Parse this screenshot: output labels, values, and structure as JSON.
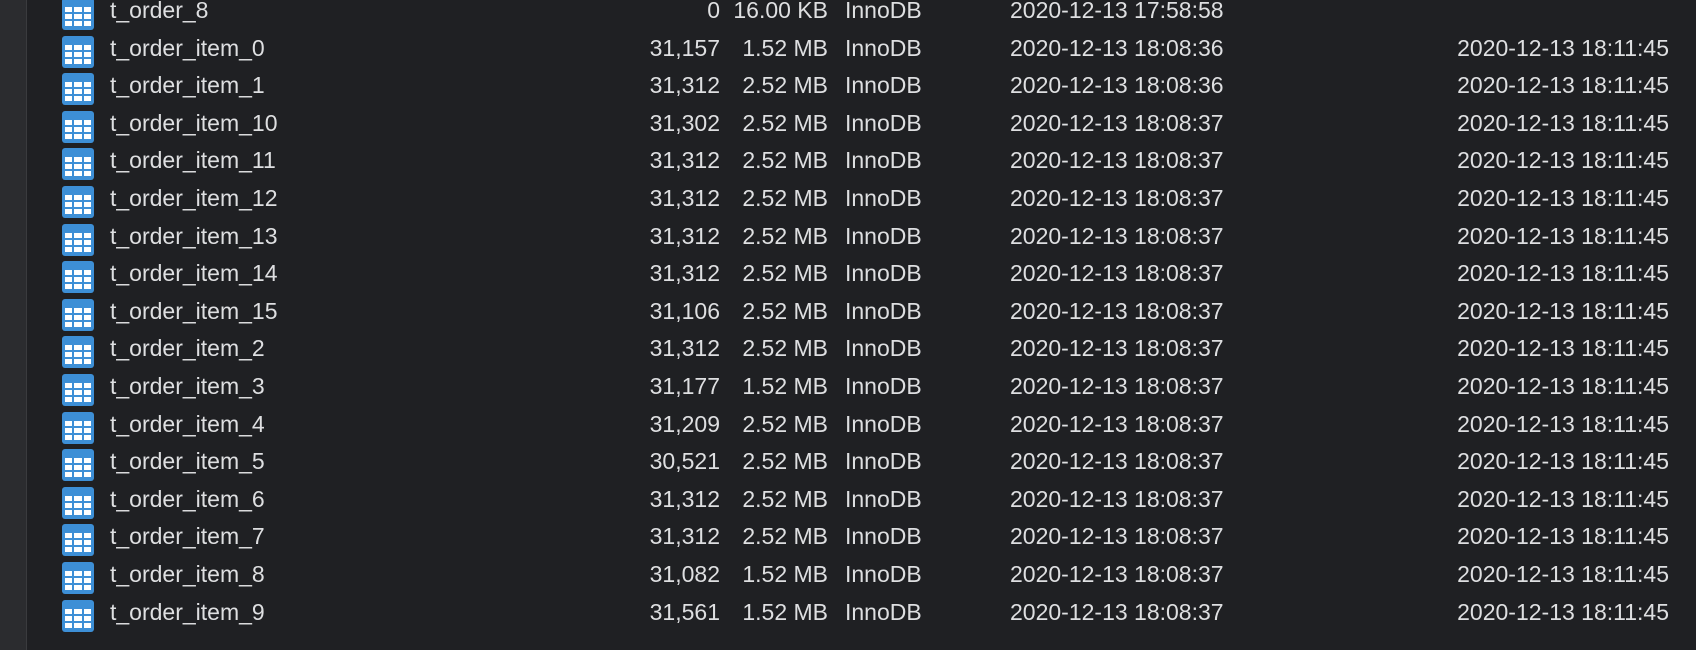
{
  "colors": {
    "background": "#1f2023",
    "text": "#dedfe1",
    "icon": "#3d8fd6"
  },
  "rows": [
    {
      "name": "t_order_8",
      "rows": "0",
      "size": "16.00 KB",
      "engine": "InnoDB",
      "created": "2020-12-13 17:58:58",
      "updated": ""
    },
    {
      "name": "t_order_item_0",
      "rows": "31,157",
      "size": "1.52 MB",
      "engine": "InnoDB",
      "created": "2020-12-13 18:08:36",
      "updated": "2020-12-13 18:11:45"
    },
    {
      "name": "t_order_item_1",
      "rows": "31,312",
      "size": "2.52 MB",
      "engine": "InnoDB",
      "created": "2020-12-13 18:08:36",
      "updated": "2020-12-13 18:11:45"
    },
    {
      "name": "t_order_item_10",
      "rows": "31,302",
      "size": "2.52 MB",
      "engine": "InnoDB",
      "created": "2020-12-13 18:08:37",
      "updated": "2020-12-13 18:11:45"
    },
    {
      "name": "t_order_item_11",
      "rows": "31,312",
      "size": "2.52 MB",
      "engine": "InnoDB",
      "created": "2020-12-13 18:08:37",
      "updated": "2020-12-13 18:11:45"
    },
    {
      "name": "t_order_item_12",
      "rows": "31,312",
      "size": "2.52 MB",
      "engine": "InnoDB",
      "created": "2020-12-13 18:08:37",
      "updated": "2020-12-13 18:11:45"
    },
    {
      "name": "t_order_item_13",
      "rows": "31,312",
      "size": "2.52 MB",
      "engine": "InnoDB",
      "created": "2020-12-13 18:08:37",
      "updated": "2020-12-13 18:11:45"
    },
    {
      "name": "t_order_item_14",
      "rows": "31,312",
      "size": "2.52 MB",
      "engine": "InnoDB",
      "created": "2020-12-13 18:08:37",
      "updated": "2020-12-13 18:11:45"
    },
    {
      "name": "t_order_item_15",
      "rows": "31,106",
      "size": "2.52 MB",
      "engine": "InnoDB",
      "created": "2020-12-13 18:08:37",
      "updated": "2020-12-13 18:11:45"
    },
    {
      "name": "t_order_item_2",
      "rows": "31,312",
      "size": "2.52 MB",
      "engine": "InnoDB",
      "created": "2020-12-13 18:08:37",
      "updated": "2020-12-13 18:11:45"
    },
    {
      "name": "t_order_item_3",
      "rows": "31,177",
      "size": "1.52 MB",
      "engine": "InnoDB",
      "created": "2020-12-13 18:08:37",
      "updated": "2020-12-13 18:11:45"
    },
    {
      "name": "t_order_item_4",
      "rows": "31,209",
      "size": "2.52 MB",
      "engine": "InnoDB",
      "created": "2020-12-13 18:08:37",
      "updated": "2020-12-13 18:11:45"
    },
    {
      "name": "t_order_item_5",
      "rows": "30,521",
      "size": "2.52 MB",
      "engine": "InnoDB",
      "created": "2020-12-13 18:08:37",
      "updated": "2020-12-13 18:11:45"
    },
    {
      "name": "t_order_item_6",
      "rows": "31,312",
      "size": "2.52 MB",
      "engine": "InnoDB",
      "created": "2020-12-13 18:08:37",
      "updated": "2020-12-13 18:11:45"
    },
    {
      "name": "t_order_item_7",
      "rows": "31,312",
      "size": "2.52 MB",
      "engine": "InnoDB",
      "created": "2020-12-13 18:08:37",
      "updated": "2020-12-13 18:11:45"
    },
    {
      "name": "t_order_item_8",
      "rows": "31,082",
      "size": "1.52 MB",
      "engine": "InnoDB",
      "created": "2020-12-13 18:08:37",
      "updated": "2020-12-13 18:11:45"
    },
    {
      "name": "t_order_item_9",
      "rows": "31,561",
      "size": "1.52 MB",
      "engine": "InnoDB",
      "created": "2020-12-13 18:08:37",
      "updated": "2020-12-13 18:11:45"
    }
  ]
}
